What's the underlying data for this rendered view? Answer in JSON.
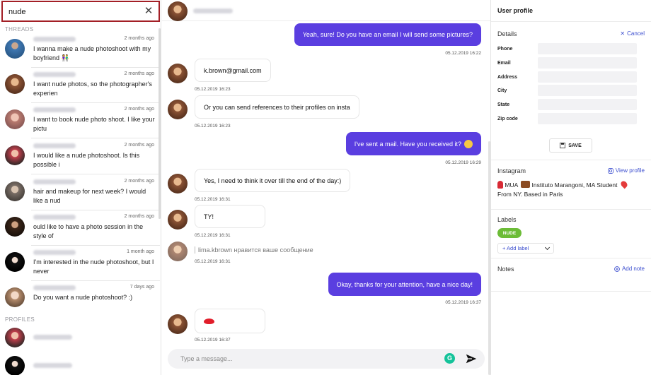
{
  "search": {
    "value": "nude"
  },
  "threads_label": "THREADS",
  "profiles_label": "PROFILES",
  "threads": [
    {
      "time": "2 months ago",
      "snippet": "I wanna make a nude photoshoot with my boyfriend 👫",
      "avatar": "av-beach"
    },
    {
      "time": "2 months ago",
      "snippet": "I want nude photos, so the photographer's experien",
      "avatar": "av-brown"
    },
    {
      "time": "2 months ago",
      "snippet": "I want to book nude photo shoot. I like your pictu",
      "avatar": "av-pink"
    },
    {
      "time": "2 months ago",
      "snippet": "I would like a nude photoshoot. Is this possible i",
      "avatar": "av-red"
    },
    {
      "time": "2 months ago",
      "snippet": "hair and makeup for next week? I would like a nud",
      "avatar": "av-grey"
    },
    {
      "time": "2 months ago",
      "snippet": "ould like to have a photo session in the style of",
      "avatar": "av-dark"
    },
    {
      "time": "1 month ago",
      "snippet": "I'm interested in the nude photoshoot, but I never",
      "avatar": "av-black"
    },
    {
      "time": "7 days ago",
      "snippet": "Do you want a nude photoshoot? :)",
      "avatar": "av-light"
    }
  ],
  "chat": {
    "messages": [
      {
        "dir": "out",
        "text": "Yeah, sure! Do you have an email I will send some pictures?",
        "time": "05.12.2019 16:22"
      },
      {
        "dir": "in",
        "text": "k.brown@gmail.com",
        "time": "05.12.2019 16:23"
      },
      {
        "dir": "in",
        "text": "Or you can send references to their profiles on insta",
        "time": "05.12.2019 16:23"
      },
      {
        "dir": "out",
        "text": "I've sent a mail. Have you received it?",
        "time": "05.12.2019 16:29"
      },
      {
        "dir": "in",
        "text": "Yes, I need to think it over till the end of the day:)",
        "time": "05.12.2019 16:31"
      },
      {
        "dir": "in",
        "text": "TY!",
        "time": "05.12.2019 16:31"
      },
      {
        "dir": "reaction",
        "text": "lima.kbrown нравится ваше сообщение",
        "time": "05.12.2019 16:31"
      },
      {
        "dir": "out",
        "text": "Okay, thanks for your attention, have a nice day!",
        "time": "05.12.2019 16:37"
      },
      {
        "dir": "in",
        "text": "",
        "time": "05.12.2019 16:37"
      }
    ],
    "composer_placeholder": "Type a message...",
    "grammarly_letter": "G"
  },
  "profile": {
    "title": "User profile",
    "details_heading": "Details",
    "cancel": "Cancel",
    "fields": [
      "Phone",
      "Email",
      "Address",
      "City",
      "State",
      "Zip code"
    ],
    "save": "SAVE",
    "instagram_heading": "Instagram",
    "view_profile": "View profile",
    "bio_part1": "MUA",
    "bio_part2": "Instituto Marangoni, MA Student",
    "bio_part3": "From NY. Based in Paris",
    "labels_heading": "Labels",
    "label_tag": "NUDE",
    "add_label": "+ Add label",
    "notes_heading": "Notes",
    "add_note": "Add note"
  },
  "colors": {
    "accent": "#5a3ee0",
    "search_border": "#a31f26",
    "tag_green": "#6cbc37",
    "link_blue": "#3d4fcf"
  }
}
